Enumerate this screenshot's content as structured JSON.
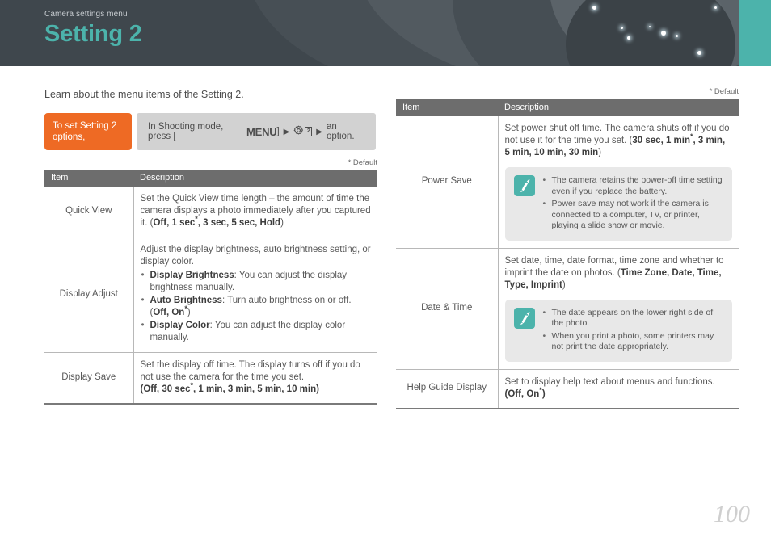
{
  "banner": {
    "kicker": "Camera settings menu",
    "title": "Setting 2",
    "bg_color": "#3f474d",
    "accent_color": "#4cb3ab"
  },
  "intro": "Learn about the menu items of the Setting 2.",
  "callout": {
    "tag": "To set Setting 2 options,",
    "tag_color": "#ee6a24",
    "instruction_prefix": "In Shooting mode, press [",
    "menu_key": "MENU",
    "instruction_bracket_close": "]",
    "arrow": "▶",
    "gear_icon_label": "gear-icon",
    "gear_number": "2",
    "instruction_suffix": "an option."
  },
  "default_note": "* Default",
  "table_headers": {
    "item": "Item",
    "description": "Description"
  },
  "left_table": {
    "rows": [
      {
        "item": "Quick View",
        "desc_lead": "Set the Quick View time length – the amount of time the camera displays a photo immediately after you captured it. (",
        "options": "Off, 1 sec*, 3 sec, 5 sec, Hold",
        "desc_tail": ")"
      },
      {
        "item": "Display Adjust",
        "desc_lead": "Adjust the display brightness, auto brightness setting, or display color.",
        "bullets": [
          {
            "term": "Display Brightness",
            "text": ": You can adjust the display brightness manually."
          },
          {
            "term": "Auto Brightness",
            "text": ": Turn auto brightness on or off. (",
            "options": "Off, On*",
            "tail": ")"
          },
          {
            "term": "Display Color",
            "text": ": You can adjust the display color manually."
          }
        ]
      },
      {
        "item": "Display Save",
        "desc_lead": "Set the display off time. The display turns off if you do not use the camera for the time you set.",
        "options_line": "(Off, 30 sec*, 1 min, 3 min, 5 min, 10 min)"
      }
    ]
  },
  "right_table": {
    "rows": [
      {
        "item": "Power Save",
        "desc_lead": "Set power shut off time. The camera shuts off if you do not use it for the time you set. (",
        "options": "30 sec, 1 min*, 3 min, 5 min, 10 min, 30 min",
        "desc_tail": ")",
        "note": {
          "icon": "pen-icon",
          "items": [
            "The camera retains the power-off time setting even if you replace the battery.",
            "Power save may not work if the camera is connected to a computer, TV, or printer, playing a slide show or movie."
          ]
        }
      },
      {
        "item": "Date & Time",
        "desc_lead": "Set date, time, date format, time zone and whether to imprint the date on photos. (",
        "options": "Time Zone, Date, Time, Type, Imprint",
        "desc_tail": ")",
        "note": {
          "icon": "pen-icon",
          "items": [
            "The date appears on the lower right side of the photo.",
            "When you print a photo, some printers may not print the date appropriately."
          ]
        }
      },
      {
        "item": "Help Guide Display",
        "desc_lead": "Set to display help text about menus and functions.",
        "options_line": "(Off, On*)"
      }
    ]
  },
  "page_number": "100"
}
